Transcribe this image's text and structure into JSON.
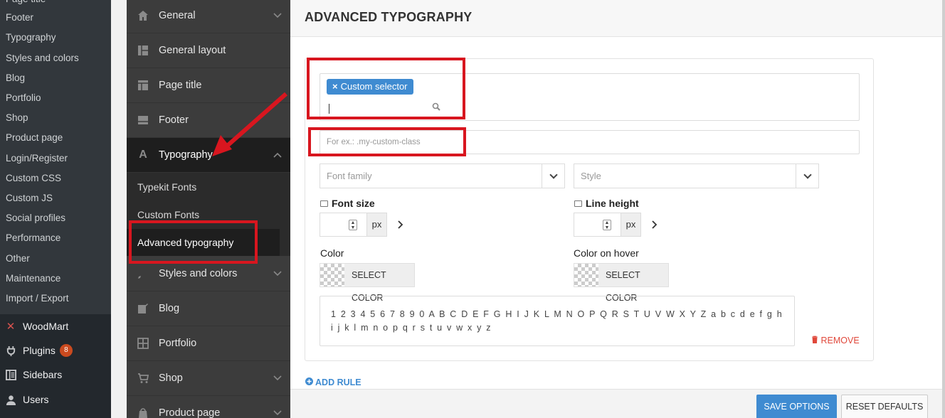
{
  "wp_sidebar": {
    "sub_items": [
      "Page title",
      "Footer",
      "Typography",
      "Styles and colors",
      "Blog",
      "Portfolio",
      "Shop",
      "Product page",
      "Login/Register",
      "Custom CSS",
      "Custom JS",
      "Social profiles",
      "Performance",
      "Other",
      "Maintenance",
      "Import / Export"
    ],
    "main_items": [
      {
        "label": "WoodMart",
        "icon": "woodmart-icon"
      },
      {
        "label": "Plugins",
        "icon": "plugin-icon",
        "badge": "8"
      },
      {
        "label": "Sidebars",
        "icon": "sidebars-icon"
      },
      {
        "label": "Users",
        "icon": "user-icon"
      }
    ]
  },
  "options_nav": {
    "items": [
      {
        "label": "General",
        "icon": "home-icon"
      },
      {
        "label": "General layout",
        "icon": "layout-icon"
      },
      {
        "label": "Page title",
        "icon": "page-title-icon"
      },
      {
        "label": "Footer",
        "icon": "footer-icon"
      },
      {
        "label": "Typography",
        "icon": "typography-icon"
      },
      {
        "label": "Styles and colors",
        "icon": "brush-icon"
      },
      {
        "label": "Blog",
        "icon": "edit-icon"
      },
      {
        "label": "Portfolio",
        "icon": "grid-icon"
      },
      {
        "label": "Shop",
        "icon": "cart-icon"
      },
      {
        "label": "Product page",
        "icon": "product-icon"
      }
    ],
    "sub_items": [
      "Typekit Fonts",
      "Custom Fonts",
      "Advanced typography"
    ]
  },
  "main": {
    "title": "ADVANCED TYPOGRAPHY",
    "selector_tag": "Custom selector",
    "custom_class_placeholder": "For ex.: .my-custom-class",
    "font_family_placeholder": "Font family",
    "style_placeholder": "Style",
    "font_size_label": "Font size",
    "line_height_label": "Line height",
    "unit": "px",
    "color_label": "Color",
    "color_hover_label": "Color on hover",
    "select_color": "SELECT COLOR",
    "preview_text": "1 2 3 4 5 6 7 8 9 0 A B C D E F G H I J K L M N O P Q R S T U V W X Y Z a b c d e f g h i j k l m n o p q r s t u v w x y z",
    "remove": "REMOVE",
    "add_rule": "ADD RULE",
    "save": "SAVE OPTIONS",
    "reset": "RESET DEFAULTS"
  },
  "colors": {
    "accent": "#3f8bd1",
    "highlight": "#d8161f",
    "remove": "#e0483b"
  }
}
